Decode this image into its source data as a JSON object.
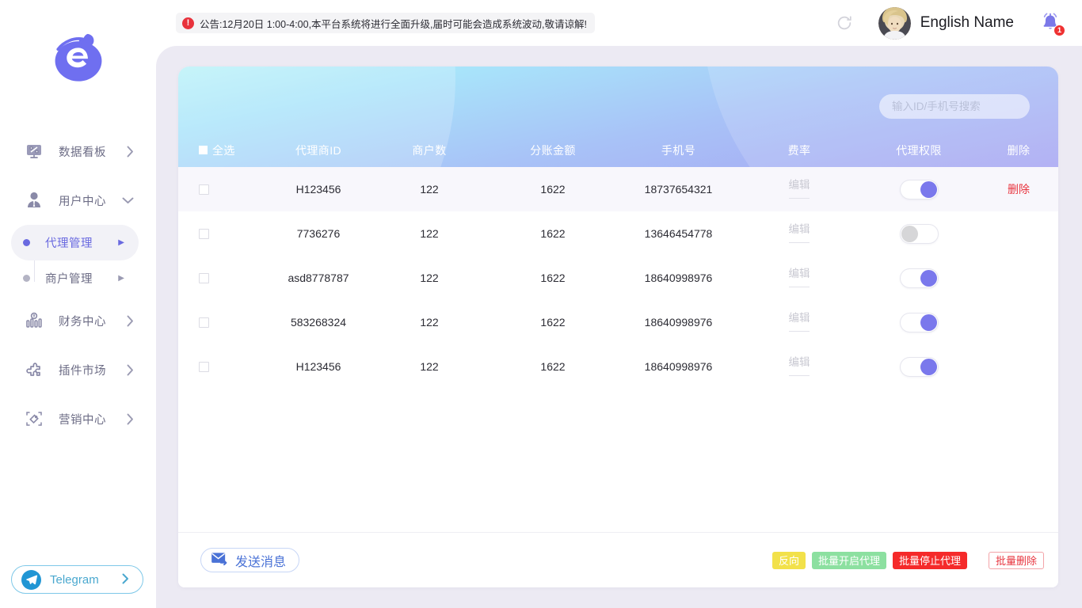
{
  "brand": {
    "logo_icon": "leaf-e-logo"
  },
  "sidebar": {
    "items": [
      {
        "label": "数据看板",
        "icon": "dashboard-icon",
        "arrow": "›"
      },
      {
        "label": "用户中心",
        "icon": "user-icon",
        "arrow": "⌄"
      },
      {
        "label": "财务中心",
        "icon": "finance-chart-icon",
        "arrow": "›"
      },
      {
        "label": "插件市场",
        "icon": "puzzle-icon",
        "arrow": "›"
      },
      {
        "label": "营销中心",
        "icon": "tag-icon",
        "arrow": "›"
      }
    ],
    "sub_items": [
      {
        "label": "代理管理",
        "arrow": "▶",
        "active": true
      },
      {
        "label": "商户管理",
        "arrow": "▶",
        "active": false
      }
    ],
    "telegram": {
      "label": "Telegram",
      "icon": "telegram-icon",
      "arrow": "›"
    }
  },
  "header": {
    "warn_icon": "!",
    "announcement": "公告:12月20日 1:00-4:00,本平台系统将进行全面升级,届时可能会造成系统波动,敬请谅解!",
    "refresh_icon": "refresh-icon",
    "avatar_icon": "user-avatar",
    "user_name": "English Name",
    "bell_icon": "bell-icon",
    "bell_badge": "1"
  },
  "search": {
    "placeholder": "输入ID/手机号搜索",
    "value": ""
  },
  "table": {
    "columns": [
      {
        "key": "select",
        "label": "全选"
      },
      {
        "key": "agent_id",
        "label": "代理商ID"
      },
      {
        "key": "merchants",
        "label": "商户数"
      },
      {
        "key": "split_amount",
        "label": "分账金额"
      },
      {
        "key": "phone",
        "label": "手机号"
      },
      {
        "key": "rate",
        "label": "费率"
      },
      {
        "key": "permission",
        "label": "代理权限"
      },
      {
        "key": "delete",
        "label": "删除"
      }
    ],
    "edit_label": "编辑",
    "delete_label": "删除",
    "rows": [
      {
        "agent_id": "H123456",
        "merchants": "122",
        "split_amount": "1622",
        "phone": "18737654321",
        "rate": "编辑",
        "toggle_on": true,
        "delete": "删除",
        "highlight": true
      },
      {
        "agent_id": "7736276",
        "merchants": "122",
        "split_amount": "1622",
        "phone": "13646454778",
        "rate": "编辑",
        "toggle_on": false,
        "delete": "",
        "highlight": false
      },
      {
        "agent_id": "asd8778787",
        "merchants": "122",
        "split_amount": "1622",
        "phone": "18640998976",
        "rate": "编辑",
        "toggle_on": true,
        "delete": "",
        "highlight": false
      },
      {
        "agent_id": "583268324",
        "merchants": "122",
        "split_amount": "1622",
        "phone": "18640998976",
        "rate": "编辑",
        "toggle_on": true,
        "delete": "",
        "highlight": false
      },
      {
        "agent_id": "H123456",
        "merchants": "122",
        "split_amount": "1622",
        "phone": "18640998976",
        "rate": "编辑",
        "toggle_on": true,
        "delete": "",
        "highlight": false
      }
    ]
  },
  "footer": {
    "send_message": {
      "label": "发送消息",
      "icon": "mail-send-icon"
    },
    "actions": [
      {
        "label": "反向",
        "style": "pill-reverse"
      },
      {
        "label": "批量开启代理",
        "style": "pill-enable"
      },
      {
        "label": "批量停止代理",
        "style": "pill-disable"
      },
      {
        "label": "批量删除",
        "style": "pill-delete"
      }
    ]
  },
  "colors": {
    "accent_purple": "#6a6ae0",
    "toggle_on": "#7a78ec",
    "toggle_off": "#d6d6d8",
    "danger_red": "#e8353f",
    "badge_red": "#ef3232",
    "yellow": "#f2e14a",
    "green": "#8ce0a0",
    "telegram_blue": "#2196d4",
    "header_gradient_start": "#b9f2f8",
    "header_gradient_end": "#a6a4f2",
    "content_bg": "#eceaf3"
  }
}
